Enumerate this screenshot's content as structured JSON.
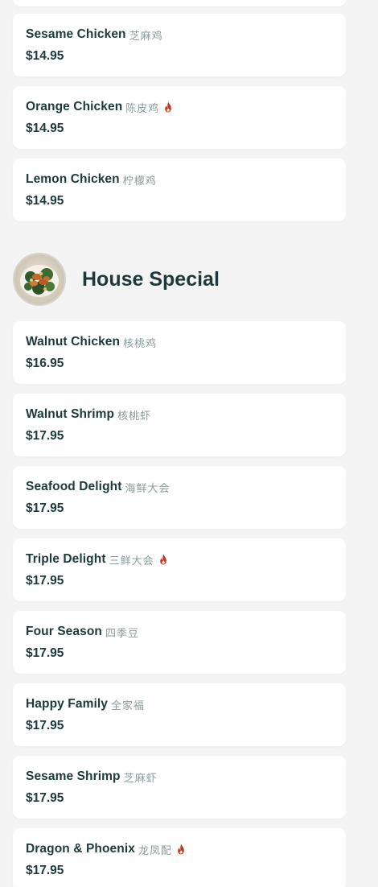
{
  "menu": {
    "items_before": [
      {
        "name": "Sesame Chicken",
        "cn": "芝麻鸡",
        "price": "$14.95",
        "spicy": false
      },
      {
        "name": "Orange Chicken",
        "cn": "陈皮鸡",
        "price": "$14.95",
        "spicy": true
      },
      {
        "name": "Lemon Chicken",
        "cn": "柠檬鸡",
        "price": "$14.95",
        "spicy": false
      }
    ],
    "category": {
      "title": "House Special",
      "thumb_icon": "house-special-dish-photo"
    },
    "items": [
      {
        "name": "Walnut Chicken",
        "cn": "核桃鸡",
        "price": "$16.95",
        "spicy": false
      },
      {
        "name": "Walnut Shrimp",
        "cn": "核桃虾",
        "price": "$17.95",
        "spicy": false
      },
      {
        "name": "Seafood Delight",
        "cn": "海鲜大会",
        "price": "$17.95",
        "spicy": false
      },
      {
        "name": "Triple Delight",
        "cn": "三鲜大会",
        "price": "$17.95",
        "spicy": true
      },
      {
        "name": "Four Season",
        "cn": "四季豆",
        "price": "$17.95",
        "spicy": false
      },
      {
        "name": "Happy Family",
        "cn": "全家福",
        "price": "$17.95",
        "spicy": false
      },
      {
        "name": "Sesame Shrimp",
        "cn": "芝麻虾",
        "price": "$17.95",
        "spicy": false
      },
      {
        "name": "Dragon & Phoenix",
        "cn": "龙凤配",
        "price": "$17.95",
        "spicy": true
      }
    ],
    "colors": {
      "text": "#1d3a3a",
      "card_bg": "#ffffff",
      "page_bg": "#f4f4f4",
      "spicy": "#c0341d"
    }
  }
}
